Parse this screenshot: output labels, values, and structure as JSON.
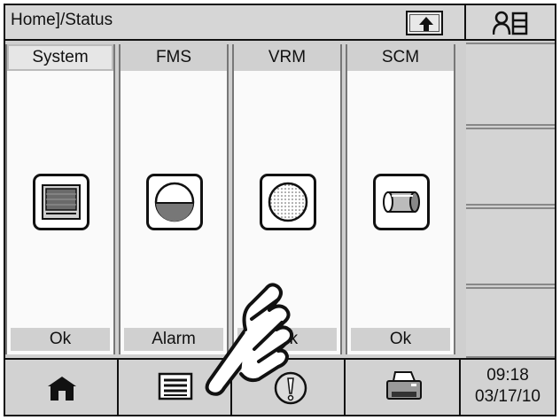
{
  "header": {
    "breadcrumb": "Home]/Status",
    "up_icon": "up-arrow-icon",
    "user_icon": "user-list-icon"
  },
  "columns": [
    {
      "title": "System",
      "status": "Ok",
      "icon": "system-monitor-icon"
    },
    {
      "title": "FMS",
      "status": "Alarm",
      "icon": "fms-tank-icon"
    },
    {
      "title": "VRM",
      "status": "Ok",
      "icon": "vrm-dotted-circle-icon"
    },
    {
      "title": "SCM",
      "status": "Ok",
      "icon": "scm-cylinder-icon"
    }
  ],
  "bottom": {
    "home_icon": "home-icon",
    "list_icon": "list-icon",
    "alarm_icon": "alarm-exclamation-icon",
    "printer_icon": "printer-icon",
    "time": "09:18",
    "date": "03/17/10"
  },
  "overlay": {
    "icon": "pointing-hand-icon"
  }
}
